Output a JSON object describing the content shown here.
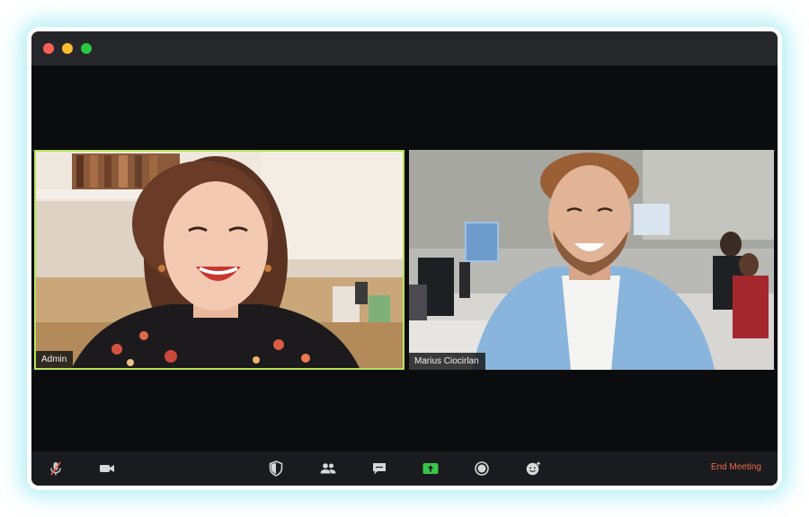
{
  "window": {
    "traffic_lights": [
      "close",
      "minimize",
      "zoom"
    ]
  },
  "participants": [
    {
      "name": "Admin",
      "active_speaker": true
    },
    {
      "name": "Marius Ciocirlan",
      "active_speaker": false
    }
  ],
  "toolbar": {
    "icons": [
      "mute-mic-icon",
      "video-icon",
      "security-shield-icon",
      "participants-icon",
      "chat-icon",
      "share-screen-icon",
      "record-icon",
      "reactions-icon"
    ],
    "end_label": "End Meeting"
  },
  "colors": {
    "active_speaker_border": "#b6e35b",
    "share_accent": "#3ac44a",
    "end_meeting": "#ee6a45",
    "glow": "#78e4ec"
  }
}
